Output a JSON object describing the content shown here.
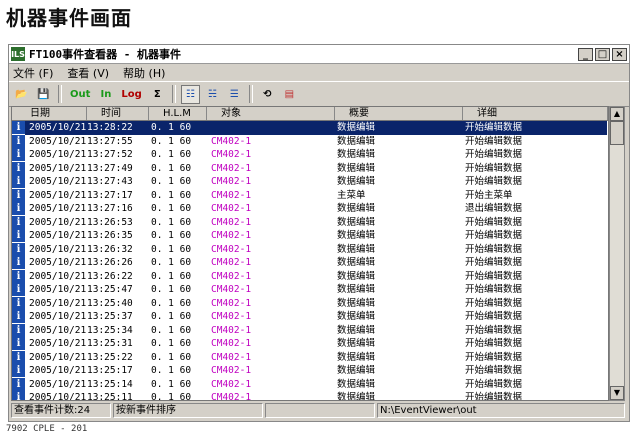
{
  "page_title": "机器事件画面",
  "window": {
    "app_icon_label": "ILS",
    "title": "FT100事件查看器 - 机器事件",
    "minimize": "_",
    "maximize": "□",
    "close": "×"
  },
  "menu": [
    "文件 (F)",
    "查看 (V)",
    "帮助 (H)"
  ],
  "toolbar": {
    "open": "📂",
    "save": "💾",
    "out": "Out",
    "in": "In",
    "log": "Log",
    "sigma": "Σ",
    "list_view": "☷",
    "tree_view": "☵",
    "detail_view": "☰",
    "refresh": "⟲",
    "report": "▤"
  },
  "columns": [
    "日期",
    "时间",
    "H.L.M",
    "对象",
    "概要",
    "详细"
  ],
  "rows": [
    {
      "date": "2005/10/21",
      "time": "13:28:22",
      "hlm": "0. 1 60",
      "obj": "",
      "summary": "数据编辑",
      "detail": "开始编辑数据",
      "selected": true
    },
    {
      "date": "2005/10/21",
      "time": "13:27:55",
      "hlm": "0. 1 60",
      "obj": "CM402-1",
      "summary": "数据编辑",
      "detail": "开始编辑数据"
    },
    {
      "date": "2005/10/21",
      "time": "13:27:52",
      "hlm": "0. 1 60",
      "obj": "CM402-1",
      "summary": "数据编辑",
      "detail": "开始编辑数据"
    },
    {
      "date": "2005/10/21",
      "time": "13:27:49",
      "hlm": "0. 1 60",
      "obj": "CM402-1",
      "summary": "数据编辑",
      "detail": "开始编辑数据"
    },
    {
      "date": "2005/10/21",
      "time": "13:27:43",
      "hlm": "0. 1 60",
      "obj": "CM402-1",
      "summary": "数据编辑",
      "detail": "开始编辑数据"
    },
    {
      "date": "2005/10/21",
      "time": "13:27:17",
      "hlm": "0. 1 60",
      "obj": "CM402-1",
      "summary": "主菜单",
      "detail": "开始主菜单"
    },
    {
      "date": "2005/10/21",
      "time": "13:27:16",
      "hlm": "0. 1 60",
      "obj": "CM402-1",
      "summary": "数据编辑",
      "detail": "退出编辑数据"
    },
    {
      "date": "2005/10/21",
      "time": "13:26:53",
      "hlm": "0. 1 60",
      "obj": "CM402-1",
      "summary": "数据编辑",
      "detail": "开始编辑数据"
    },
    {
      "date": "2005/10/21",
      "time": "13:26:35",
      "hlm": "0. 1 60",
      "obj": "CM402-1",
      "summary": "数据编辑",
      "detail": "开始编辑数据"
    },
    {
      "date": "2005/10/21",
      "time": "13:26:32",
      "hlm": "0. 1 60",
      "obj": "CM402-1",
      "summary": "数据编辑",
      "detail": "开始编辑数据"
    },
    {
      "date": "2005/10/21",
      "time": "13:26:26",
      "hlm": "0. 1 60",
      "obj": "CM402-1",
      "summary": "数据编辑",
      "detail": "开始编辑数据"
    },
    {
      "date": "2005/10/21",
      "time": "13:26:22",
      "hlm": "0. 1 60",
      "obj": "CM402-1",
      "summary": "数据编辑",
      "detail": "开始编辑数据"
    },
    {
      "date": "2005/10/21",
      "time": "13:25:47",
      "hlm": "0. 1 60",
      "obj": "CM402-1",
      "summary": "数据编辑",
      "detail": "开始编辑数据"
    },
    {
      "date": "2005/10/21",
      "time": "13:25:40",
      "hlm": "0. 1 60",
      "obj": "CM402-1",
      "summary": "数据编辑",
      "detail": "开始编辑数据"
    },
    {
      "date": "2005/10/21",
      "time": "13:25:37",
      "hlm": "0. 1 60",
      "obj": "CM402-1",
      "summary": "数据编辑",
      "detail": "开始编辑数据"
    },
    {
      "date": "2005/10/21",
      "time": "13:25:34",
      "hlm": "0. 1 60",
      "obj": "CM402-1",
      "summary": "数据编辑",
      "detail": "开始编辑数据"
    },
    {
      "date": "2005/10/21",
      "time": "13:25:31",
      "hlm": "0. 1 60",
      "obj": "CM402-1",
      "summary": "数据编辑",
      "detail": "开始编辑数据"
    },
    {
      "date": "2005/10/21",
      "time": "13:25:22",
      "hlm": "0. 1 60",
      "obj": "CM402-1",
      "summary": "数据编辑",
      "detail": "开始编辑数据"
    },
    {
      "date": "2005/10/21",
      "time": "13:25:17",
      "hlm": "0. 1 60",
      "obj": "CM402-1",
      "summary": "数据编辑",
      "detail": "开始编辑数据"
    },
    {
      "date": "2005/10/21",
      "time": "13:25:14",
      "hlm": "0. 1 60",
      "obj": "CM402-1",
      "summary": "数据编辑",
      "detail": "开始编辑数据"
    },
    {
      "date": "2005/10/21",
      "time": "13:25:11",
      "hlm": "0. 1 60",
      "obj": "CM402-1",
      "summary": "数据编辑",
      "detail": "开始编辑数据"
    }
  ],
  "row_icon": "i",
  "status": {
    "count": "查看事件计数:24",
    "sort": "按新事件排序",
    "blank": "",
    "path": "N:\\EventViewer\\out"
  },
  "caption": "7902 CPLE - 201"
}
